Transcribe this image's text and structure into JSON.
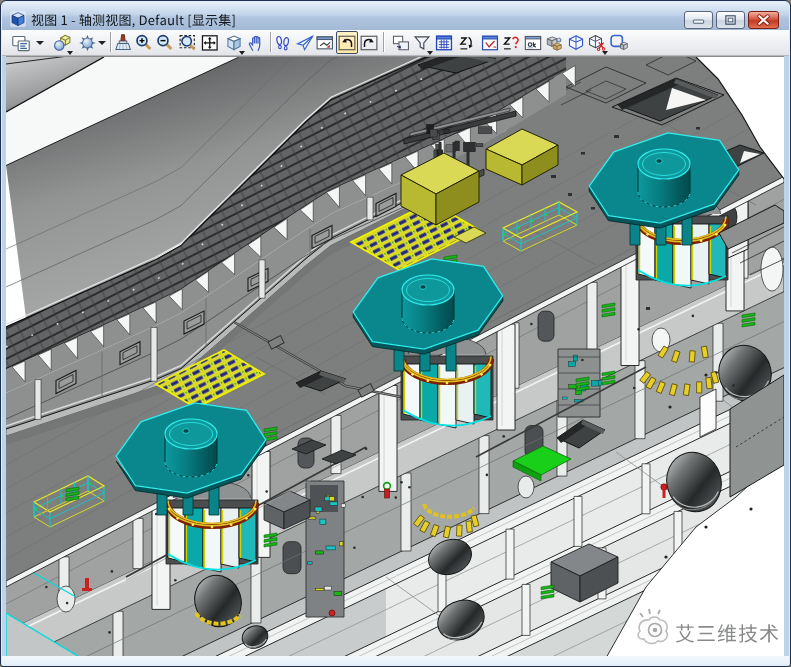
{
  "window": {
    "title": "视图 1 - 轴测视图, Default [显示集]",
    "icon": "view-cube-icon",
    "controls": [
      {
        "name": "minimize",
        "glyph": "–"
      },
      {
        "name": "restore",
        "glyph": "▢"
      },
      {
        "name": "close",
        "glyph": "✕"
      }
    ]
  },
  "toolbar": {
    "items": [
      {
        "name": "view-display-mode",
        "icon": "ic-view-display",
        "dropdown": "right"
      },
      {
        "name": "display-style",
        "icon": "ic-display-style",
        "dropdown": "below"
      },
      {
        "name": "adjust-view-brightness",
        "icon": "ic-brightness",
        "dropdown": "right"
      },
      {
        "sep": true
      },
      {
        "name": "update-view",
        "icon": "ic-update"
      },
      {
        "name": "zoom-in",
        "icon": "ic-zoom-in"
      },
      {
        "name": "zoom-out",
        "icon": "ic-zoom-out"
      },
      {
        "name": "window-area",
        "icon": "ic-window-area"
      },
      {
        "name": "fit-view",
        "icon": "ic-fit"
      },
      {
        "name": "rotate-view",
        "icon": "ic-rotate",
        "dropdown": "below"
      },
      {
        "name": "pan-view",
        "icon": "ic-pan"
      },
      {
        "sep": true
      },
      {
        "name": "walk",
        "icon": "ic-walk"
      },
      {
        "name": "fly",
        "icon": "ic-fly"
      },
      {
        "name": "navigate-view",
        "icon": "ic-navigate"
      },
      {
        "name": "view-previous",
        "icon": "ic-view-prev",
        "active": true
      },
      {
        "name": "view-next",
        "icon": "ic-view-next"
      },
      {
        "sep": true
      },
      {
        "name": "copy-view",
        "icon": "ic-copy-view"
      },
      {
        "name": "clip-volume",
        "icon": "ic-clip-volume",
        "dropdown": "below"
      },
      {
        "name": "set-display-depth",
        "icon": "ic-set-ddepth"
      },
      {
        "name": "set-active-depth",
        "icon": "ic-set-adepth"
      },
      {
        "name": "show-display-depth",
        "icon": "ic-show-ddepth"
      },
      {
        "name": "show-active-depth",
        "icon": "ic-show-adepth"
      },
      {
        "name": "camera-settings",
        "icon": "ic-camera-settings"
      },
      {
        "name": "render",
        "icon": "ic-render"
      },
      {
        "name": "define-camera",
        "icon": "ic-define-camera"
      },
      {
        "name": "clip-mask",
        "icon": "ic-clip-mask",
        "dropdown": "below"
      },
      {
        "name": "apply-saved-view",
        "icon": "ic-apply-view"
      }
    ]
  },
  "viewport": {
    "watermark": {
      "text": "艾三维技术",
      "logo": "camera-logo"
    },
    "scene": {
      "type": "3d-cad-isometric-model",
      "subject": "ship block / offshore platform deck structure",
      "objects": [
        "curved hull shell plating (top-left)",
        "weather deck strip with grating and bracket row",
        "main deck with three teal cylindrical tanks on octagonal platforms",
        "tank internals cut through deck (yellow ring flange, teal/white staves)",
        "yellow equipment skids and overhead crane rails",
        "yellow pallet racks with blue fittings",
        "deck hatches",
        "bulkhead walls with pillars and door openings",
        "lower hull with elliptical pipe penetrations and stringers",
        "green vent grilles",
        "red mast at deck edge"
      ]
    }
  },
  "palette": {
    "titlebar": "#bcd0e8",
    "toolbar": "#eff0f2",
    "accent_active": "#ffe8a6",
    "deck_gray": "#7d7f7e",
    "wall_gray": "#999c9b",
    "tank_teal": "#067f82",
    "edge_cyan": "#00d8d8",
    "equipment_yellow": "#d9d955",
    "rack_navy": "#1c2070",
    "vent_green": "#17b417",
    "alert_red": "#cc2020",
    "close_red": "#d04a38"
  }
}
